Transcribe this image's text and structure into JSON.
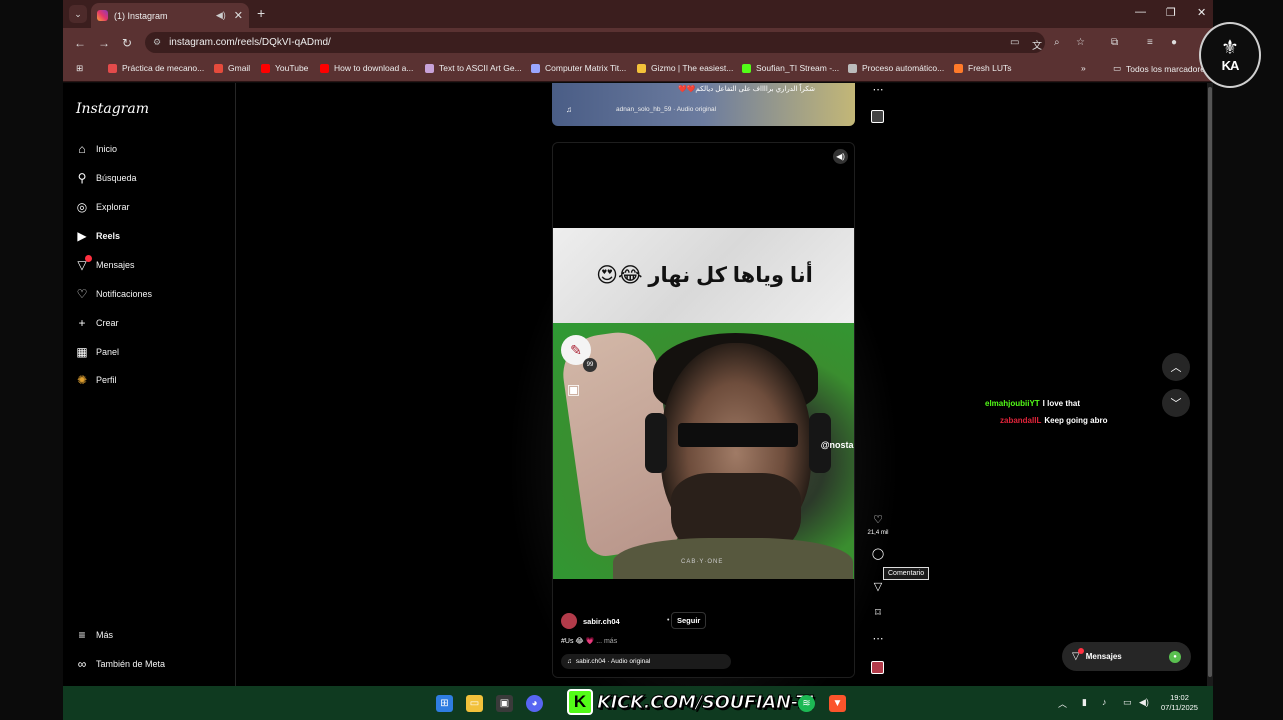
{
  "browser": {
    "tab_title": "(1) Instagram",
    "url": "instagram.com/reels/DQkVI-qADmd/",
    "bookmarks": [
      {
        "label": "Práctica de mecano...",
        "color": "#e34b4b"
      },
      {
        "label": "Gmail",
        "color": "#e54b3c"
      },
      {
        "label": "YouTube",
        "color": "#ff0000"
      },
      {
        "label": "How to download a...",
        "color": "#ff0000"
      },
      {
        "label": "Text to ASCII Art Ge...",
        "color": "#c8a2d8"
      },
      {
        "label": "Computer Matrix Tit...",
        "color": "#9aa6ff"
      },
      {
        "label": "Gizmo | The easiest...",
        "color": "#f3c23a"
      },
      {
        "label": "Soufian_TI Stream -...",
        "color": "#53fc18"
      },
      {
        "label": "Proceso automático...",
        "color": "#bbbbbb"
      },
      {
        "label": "Fresh LUTs",
        "color": "#ff7a2a"
      }
    ],
    "all_bookmarks": "Todos los marcadores"
  },
  "sidebar": {
    "logo": "Instagram",
    "items": [
      {
        "label": "Inicio",
        "icon": "home-icon"
      },
      {
        "label": "Búsqueda",
        "icon": "search-icon"
      },
      {
        "label": "Explorar",
        "icon": "compass-icon"
      },
      {
        "label": "Reels",
        "icon": "reels-icon"
      },
      {
        "label": "Mensajes",
        "icon": "messages-icon"
      },
      {
        "label": "Notificaciones",
        "icon": "heart-icon"
      },
      {
        "label": "Crear",
        "icon": "plus-icon"
      },
      {
        "label": "Panel",
        "icon": "dashboard-icon"
      },
      {
        "label": "Perfil",
        "icon": "profile-icon"
      }
    ],
    "more": "Más",
    "meta": "También de Meta"
  },
  "prev_reel": {
    "text": "شكراً الدراري برااااف على التفاعل ديالكم❤️❤️",
    "audio": "adnan_solo_hb_59 · Audio original"
  },
  "reel": {
    "overlay_text": "أنا وياها كل نهار 😂😍",
    "watermark": "@nostal",
    "caption_strip": "CAB·Y·ONE",
    "sticker_count": "99",
    "username": "sabir.ch04",
    "follow_label": "Seguir",
    "caption": "#Us 😂 💗",
    "caption_more": "... más",
    "audio": "sabir.ch04 · Audio original",
    "likes": "21,4 mil",
    "tooltip": "Comentario"
  },
  "chat": [
    {
      "user": "elmahjoubiiYT",
      "message": "I love that",
      "color": "#53fc18"
    },
    {
      "user": "zabandaIIL",
      "message": "Keep going abro",
      "color": "#e0243a"
    }
  ],
  "messages_pill": {
    "label": "Mensajes"
  },
  "overlay": {
    "kick_text": "KICK.COM/SOUFIAN-TI"
  },
  "taskbar": {
    "time": "19:02",
    "date": "07/11/2025"
  }
}
